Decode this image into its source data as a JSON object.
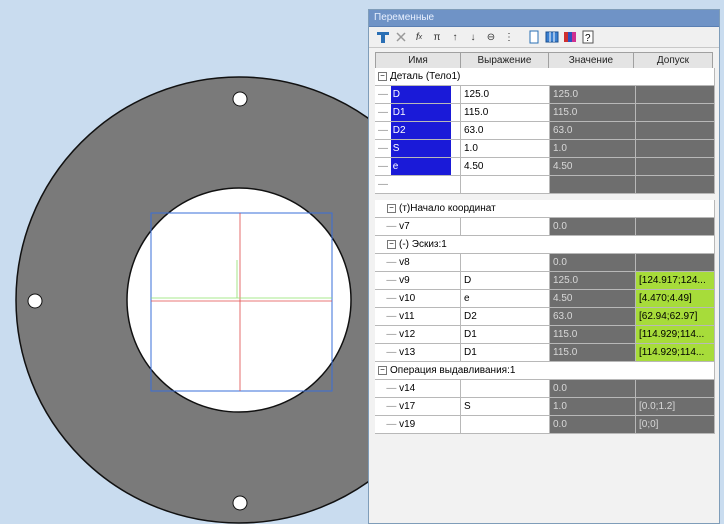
{
  "panel": {
    "title": "Переменные",
    "columns": [
      "Имя",
      "Выражение",
      "Значение",
      "Допуск"
    ]
  },
  "toolbar": {
    "icons": [
      "table-icon",
      "delete-icon",
      "function-icon",
      "pi-icon",
      "arrow-up-icon",
      "arrow-down-icon",
      "link-icon",
      "tree-icon",
      "document-icon",
      "grid-icon",
      "colors-icon",
      "help-icon"
    ]
  },
  "groups": [
    {
      "label": "Деталь (Тело1)",
      "rows": [
        {
          "name": "D",
          "expr": "125.0",
          "value": "125.0",
          "tol": "",
          "selected": true
        },
        {
          "name": "D1",
          "expr": "115.0",
          "value": "115.0",
          "tol": "",
          "selected": true
        },
        {
          "name": "D2",
          "expr": "63.0",
          "value": "63.0",
          "tol": "",
          "selected": true
        },
        {
          "name": "S",
          "expr": "1.0",
          "value": "1.0",
          "tol": "",
          "selected": true
        },
        {
          "name": "e",
          "expr": "4.50",
          "value": "4.50",
          "tol": "",
          "selected": true
        },
        {
          "name": "",
          "expr": "",
          "value": "",
          "tol": "",
          "selected": false
        }
      ]
    },
    {
      "label": "(т)Начало координат",
      "rows": [
        {
          "name": "v7",
          "expr": "",
          "value": "0.0",
          "tol": "",
          "selected": false
        }
      ]
    },
    {
      "label": "(-) Эскиз:1",
      "rows": [
        {
          "name": "v8",
          "expr": "",
          "value": "0.0",
          "tol": "",
          "selected": false
        },
        {
          "name": "v9",
          "expr": "D",
          "value": "125.0",
          "tol": "[124.917;124...",
          "selected": false,
          "green": true
        },
        {
          "name": "v10",
          "expr": "e",
          "value": "4.50",
          "tol": "[4.470;4.49]",
          "selected": false,
          "green": true
        },
        {
          "name": "v11",
          "expr": "D2",
          "value": "63.0",
          "tol": "[62.94;62.97]",
          "selected": false,
          "green": true
        },
        {
          "name": "v12",
          "expr": "D1",
          "value": "115.0",
          "tol": "[114.929;114...",
          "selected": false,
          "green": true
        },
        {
          "name": "v13",
          "expr": "D1",
          "value": "115.0",
          "tol": "[114.929;114...",
          "selected": false,
          "green": true
        }
      ]
    },
    {
      "label": "Операция выдавливания:1",
      "rows": [
        {
          "name": "v14",
          "expr": "",
          "value": "0.0",
          "tol": "",
          "selected": false
        },
        {
          "name": "v17",
          "expr": "S",
          "value": "1.0",
          "tol": "[0.0;1.2]",
          "selected": false
        },
        {
          "name": "v19",
          "expr": "",
          "value": "0.0",
          "tol": "[0;0]",
          "selected": false
        }
      ]
    }
  ],
  "colors": {
    "part_fill": "#7a7a7a",
    "background": "#c9dcef",
    "selection_blue": "#1a1ad8",
    "tolerance_green": "#a7dc3a"
  }
}
